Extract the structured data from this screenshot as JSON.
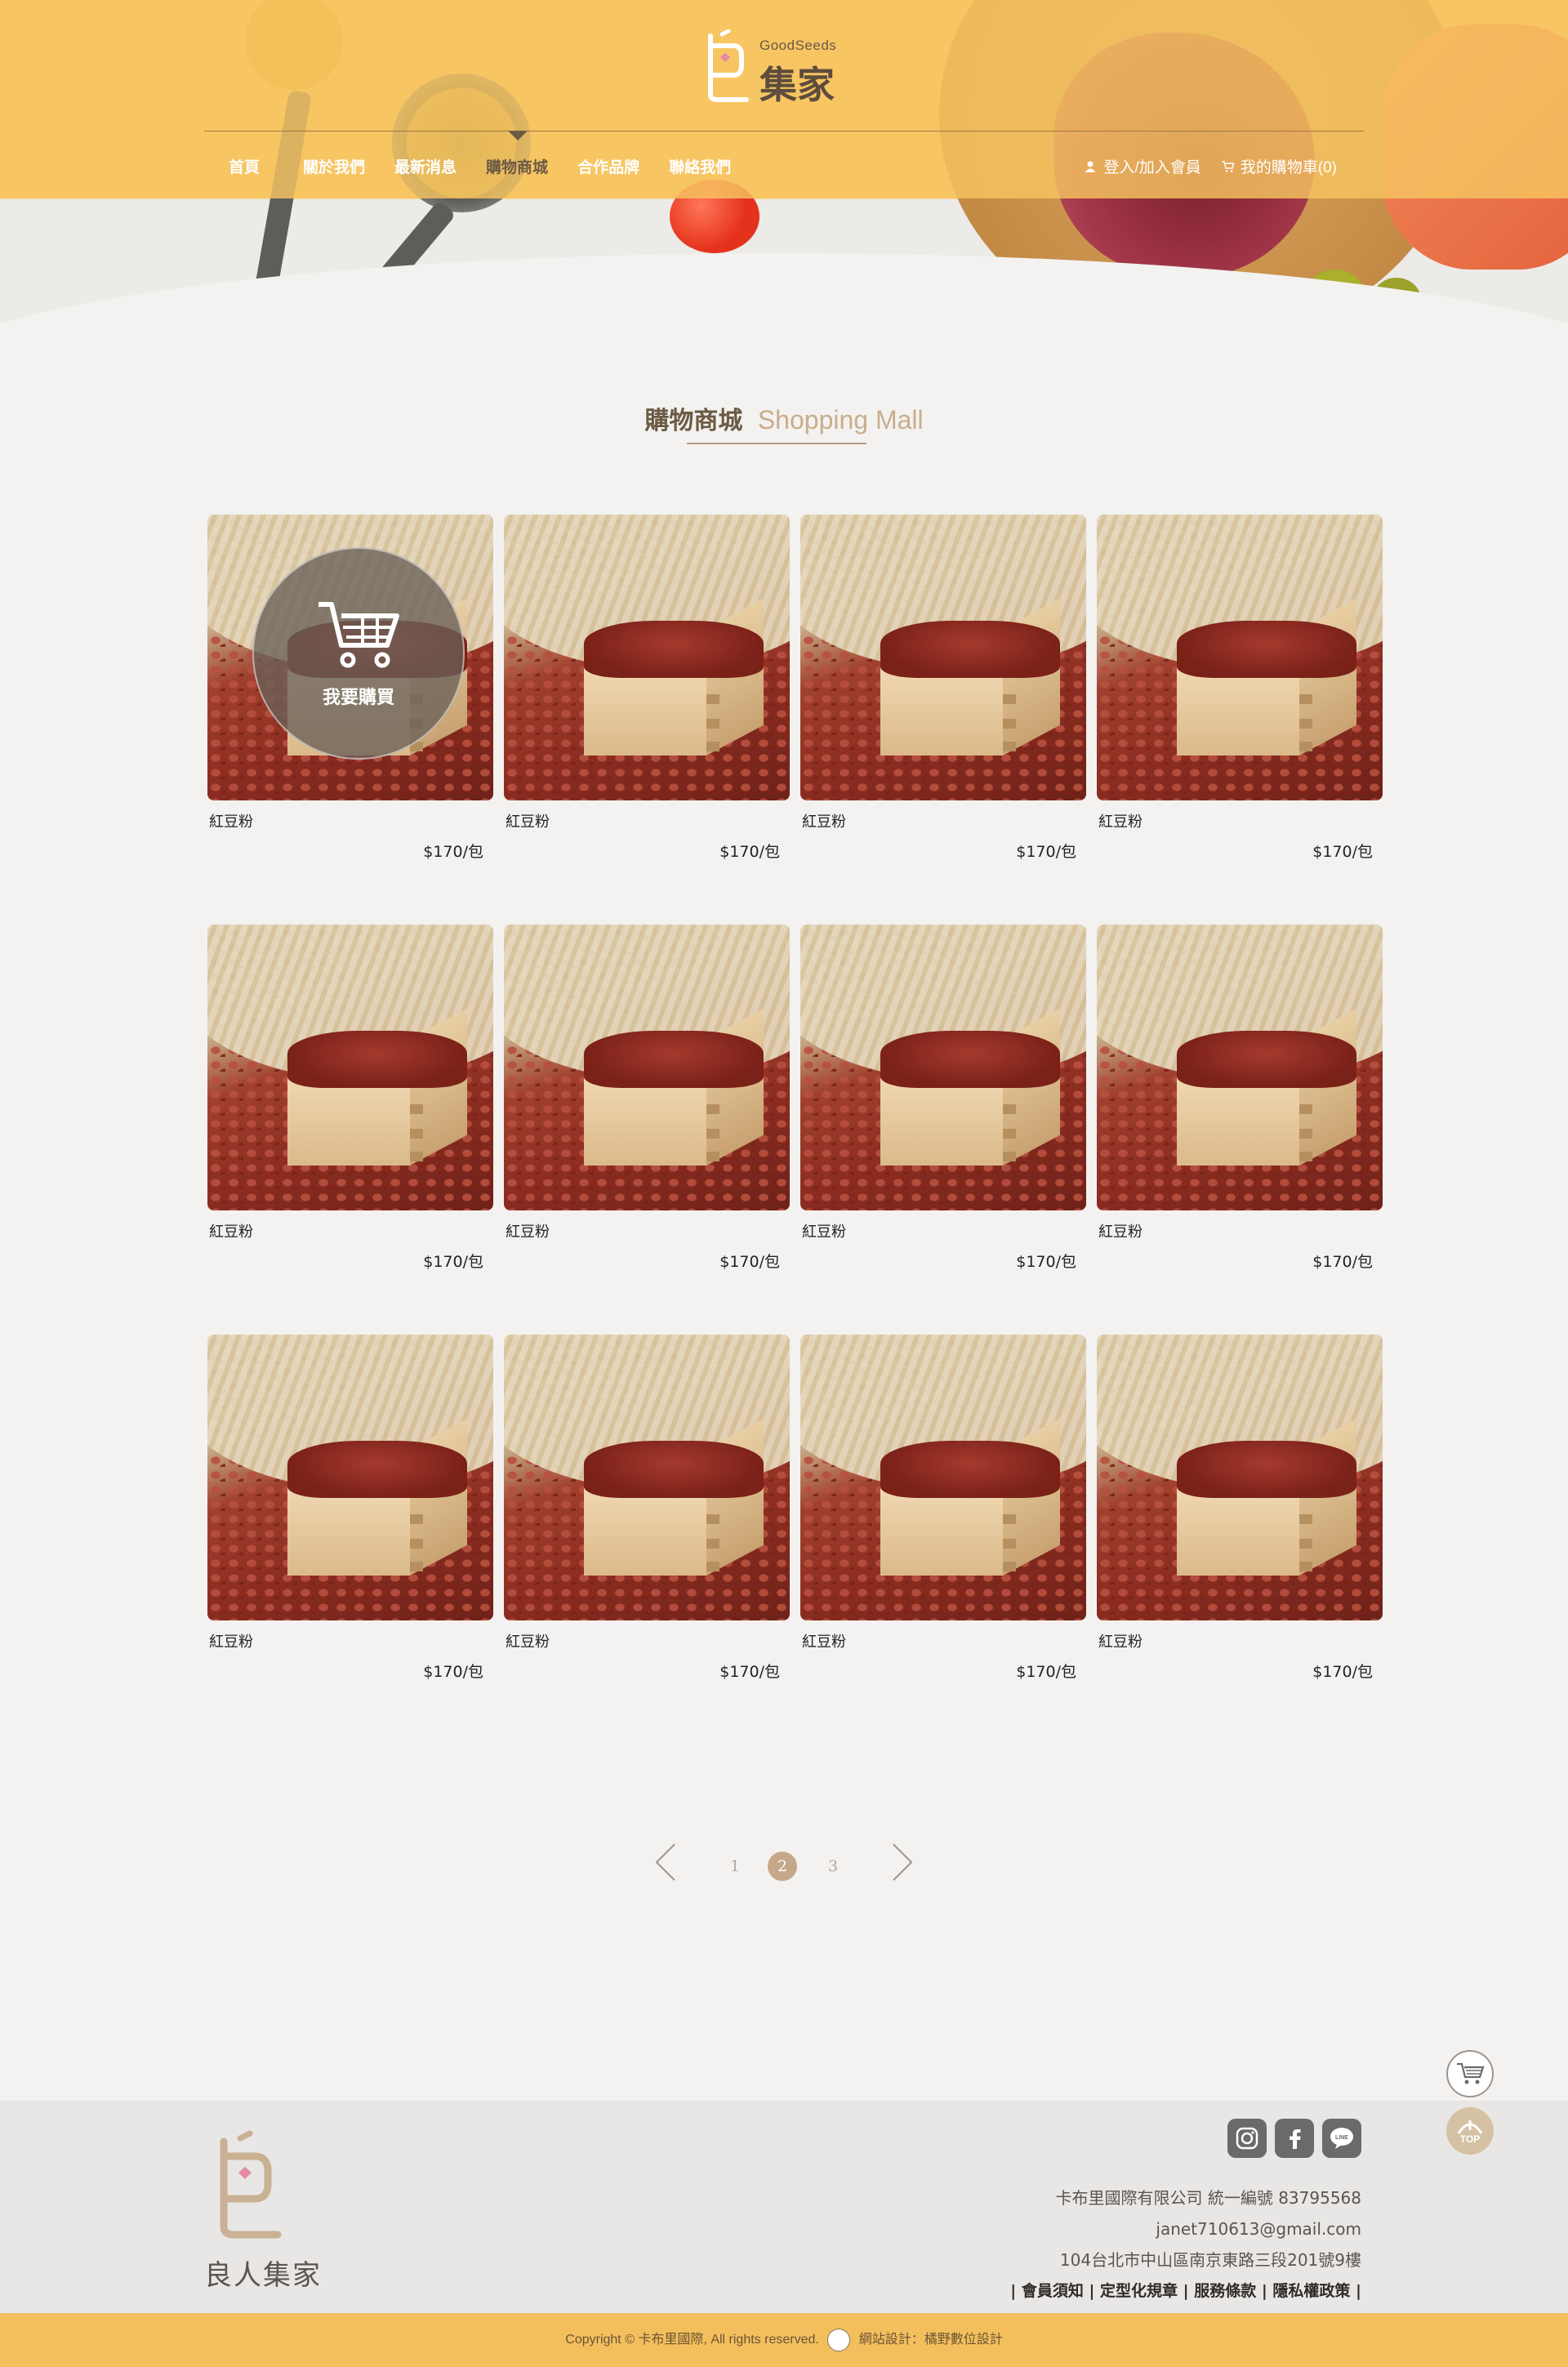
{
  "brand": {
    "english": "GoodSeeds",
    "chinese": "集家",
    "full_name": "良人集家"
  },
  "nav": {
    "items": [
      {
        "label": "首頁",
        "active": false
      },
      {
        "label": "關於我們",
        "active": false
      },
      {
        "label": "最新消息",
        "active": false
      },
      {
        "label": "購物商城",
        "active": true
      },
      {
        "label": "合作品牌",
        "active": false
      },
      {
        "label": "聯絡我們",
        "active": false
      }
    ],
    "login": "登入/加入會員",
    "cart": "我的購物車(0)"
  },
  "page": {
    "title_zh": "購物商城",
    "title_en": "Shopping Mall"
  },
  "products": {
    "buy_label": "我要購買",
    "items": [
      {
        "name": "紅豆粉",
        "price": "$170/包"
      },
      {
        "name": "紅豆粉",
        "price": "$170/包"
      },
      {
        "name": "紅豆粉",
        "price": "$170/包"
      },
      {
        "name": "紅豆粉",
        "price": "$170/包"
      },
      {
        "name": "紅豆粉",
        "price": "$170/包"
      },
      {
        "name": "紅豆粉",
        "price": "$170/包"
      },
      {
        "name": "紅豆粉",
        "price": "$170/包"
      },
      {
        "name": "紅豆粉",
        "price": "$170/包"
      },
      {
        "name": "紅豆粉",
        "price": "$170/包"
      },
      {
        "name": "紅豆粉",
        "price": "$170/包"
      },
      {
        "name": "紅豆粉",
        "price": "$170/包"
      },
      {
        "name": "紅豆粉",
        "price": "$170/包"
      }
    ]
  },
  "pagination": {
    "pages": [
      "1",
      "2",
      "3"
    ],
    "current": "2"
  },
  "floating": {
    "top_label": "TOP"
  },
  "footer": {
    "company": "卡布里國際有限公司  統一編號 83795568",
    "email": "janet710613@gmail.com",
    "address": "104台北市中山區南京東路三段201號9樓",
    "links": [
      "會員須知",
      "定型化規章",
      "服務條款",
      "隱私權政策"
    ],
    "social": [
      "instagram-icon",
      "facebook-icon",
      "line-icon"
    ],
    "line_badge": "LINE",
    "copyright_left": "Copyright © 卡布里國際, All rights reserved.",
    "copyright_right": "網站設計：橘野數位設計"
  },
  "colors": {
    "header": "#f6c869",
    "accent_brown": "#6b5a44",
    "pager_active": "#c5a88a",
    "footer_band": "#f3bf5d"
  }
}
